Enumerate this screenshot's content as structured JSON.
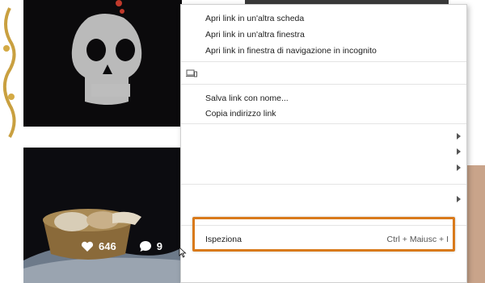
{
  "context_menu": {
    "items": [
      {
        "label": "Apri link in un'altra scheda"
      },
      {
        "label": "Apri link in un'altra finestra"
      },
      {
        "label": "Apri link in finestra di navigazione in incognito"
      },
      {
        "label": "Salva link con nome..."
      },
      {
        "label": "Copia indirizzo link"
      }
    ],
    "inspect": {
      "label": "Ispeziona",
      "shortcut": "Ctrl + Maiusc + I"
    },
    "device_icon": "cast-device-icon"
  },
  "post_overlay": {
    "likes": "646",
    "comments": "9"
  },
  "colors": {
    "highlight": "#d97a1b",
    "menu_bg": "#ffffff"
  }
}
